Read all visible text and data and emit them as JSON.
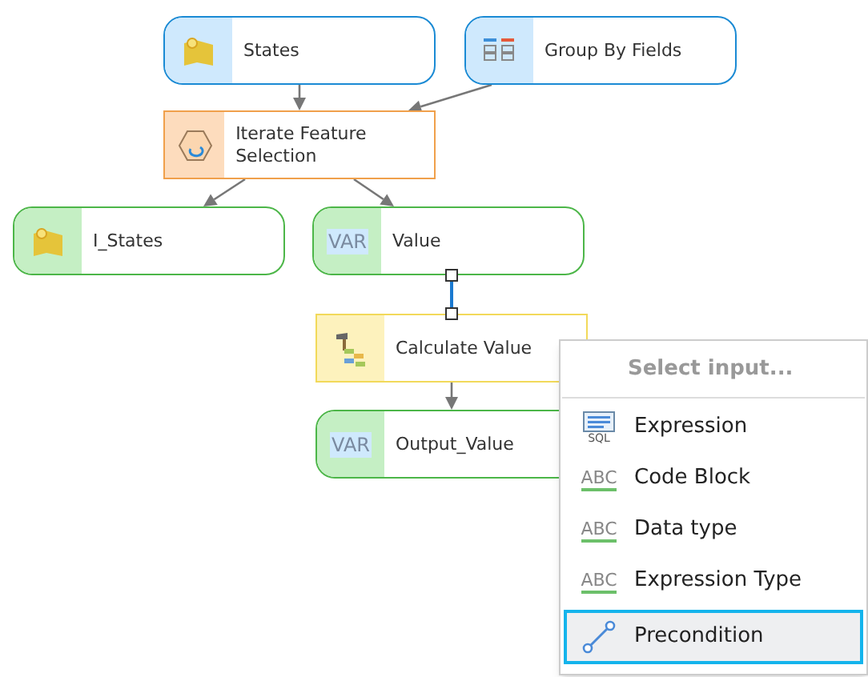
{
  "nodes": [
    {
      "label": "States",
      "kind": "input_dataset"
    },
    {
      "label": "Group By Fields",
      "kind": "input_table"
    },
    {
      "label": "Iterate Feature Selection",
      "kind": "iterator"
    },
    {
      "label": "I_States",
      "kind": "output_dataset"
    },
    {
      "label": "Value",
      "kind": "output_variable",
      "icon_text": "VAR"
    },
    {
      "label": "Calculate Value",
      "kind": "tool"
    },
    {
      "label": "Output_Value",
      "kind": "output_variable",
      "icon_text": "VAR"
    }
  ],
  "menu": {
    "header": "Select input...",
    "items": [
      {
        "label": "Expression",
        "kind": "sql",
        "icon_text": "SQL",
        "selected": false
      },
      {
        "label": "Code Block",
        "kind": "abc",
        "icon_text": "ABC",
        "selected": false
      },
      {
        "label": "Data type",
        "kind": "abc",
        "icon_text": "ABC",
        "selected": false
      },
      {
        "label": "Expression Type",
        "kind": "abc",
        "icon_text": "ABC",
        "selected": false
      },
      {
        "label": "Precondition",
        "kind": "link",
        "selected": true
      }
    ]
  }
}
